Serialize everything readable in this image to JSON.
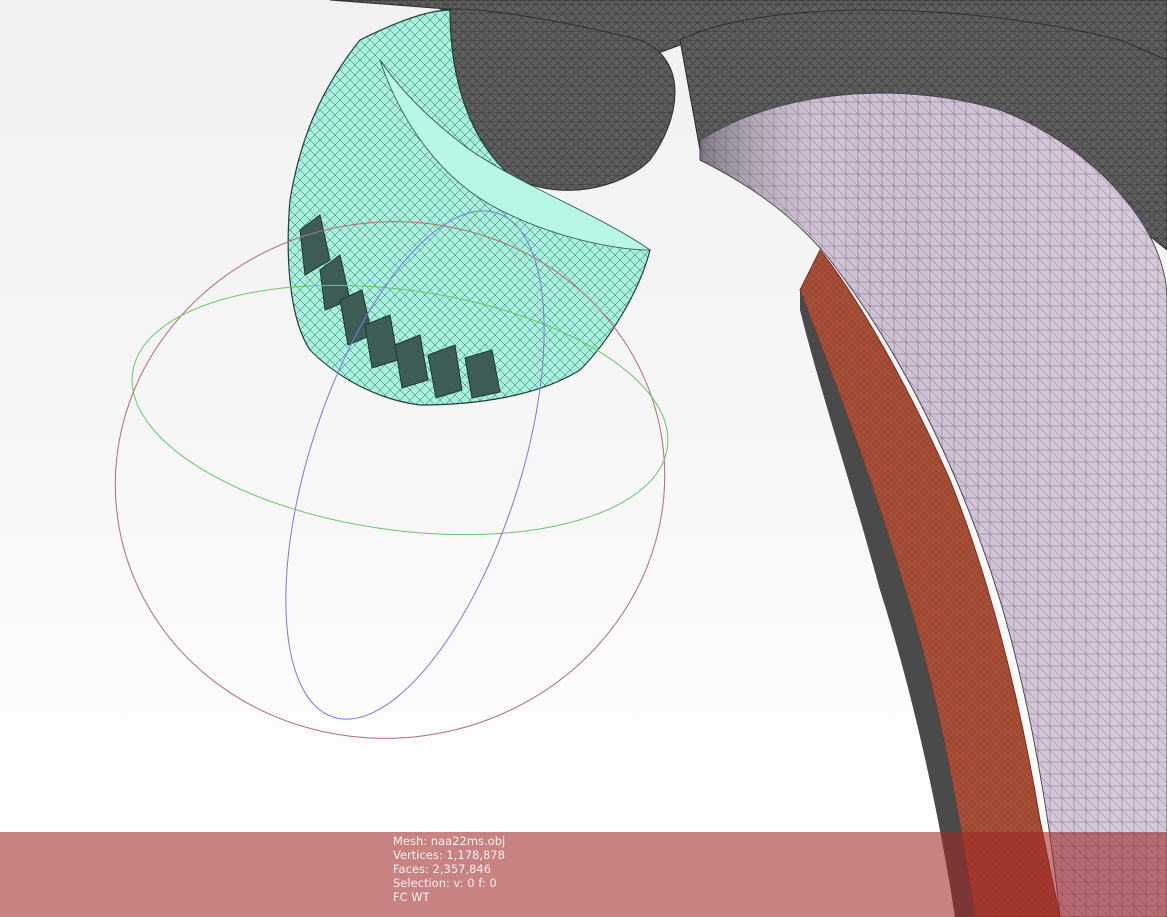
{
  "viewport": {
    "background_top": "#f1f1f1",
    "background_bottom": "#ffffff",
    "mesh_colors": {
      "dark_body": "#5a5a5a",
      "handle_lilac": "#cbbcd0",
      "selected_part_cyan": "#a6f0dd",
      "edge_orange": "#b4452a"
    },
    "trackball_colors": {
      "x_ring": "#c86a6a",
      "y_ring": "#6ac66a",
      "z_ring": "#7a7ad6"
    }
  },
  "info_panel": {
    "mesh": "Mesh: naa22ms.obj",
    "vertices": "Vertices: 1,178,878",
    "faces": "Faces: 2,357,846",
    "selection": "Selection: v: 0 f: 0",
    "mode": "FC WT"
  }
}
